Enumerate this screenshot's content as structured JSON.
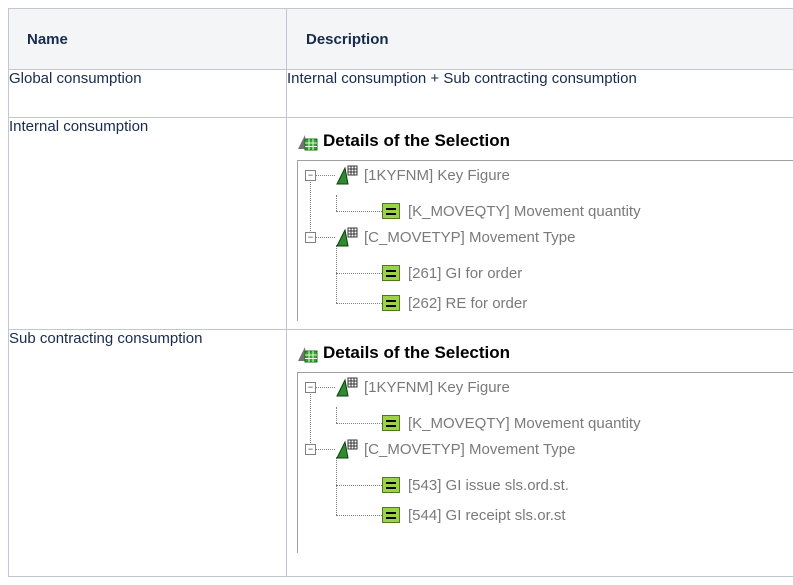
{
  "table": {
    "headers": {
      "name": "Name",
      "description": "Description"
    },
    "rows": [
      {
        "name": "Global consumption",
        "description": "Internal consumption + Sub contracting consumption"
      },
      {
        "name": "Internal consumption",
        "selection": {
          "title": "Details of the Selection",
          "groups": [
            {
              "label": "[1KYFNM] Key Figure",
              "items": [
                "[K_MOVEQTY] Movement quantity"
              ]
            },
            {
              "label": "[C_MOVETYP] Movement Type",
              "items": [
                "[261] GI for order",
                "[262] RE for order"
              ]
            }
          ]
        }
      },
      {
        "name": "Sub contracting consumption",
        "selection": {
          "title": "Details of the Selection",
          "groups": [
            {
              "label": "[1KYFNM] Key Figure",
              "items": [
                "[K_MOVEQTY] Movement quantity"
              ]
            },
            {
              "label": "[C_MOVETYP] Movement Type",
              "items": [
                "[543] GI issue sls.ord.st.",
                "[544] GI receipt sls.or.st"
              ]
            }
          ]
        }
      }
    ]
  },
  "icons": {
    "header": "selection-details-icon",
    "group": "characteristic-triangle-icon",
    "item": "equals-icon",
    "expander": "collapse-minus-icon"
  },
  "colors": {
    "equals_fill": "#9bd24a",
    "triangle_fill": "#2e8b2e",
    "tree_text": "#7a7a7a",
    "header_bg": "#f4f5f7"
  }
}
